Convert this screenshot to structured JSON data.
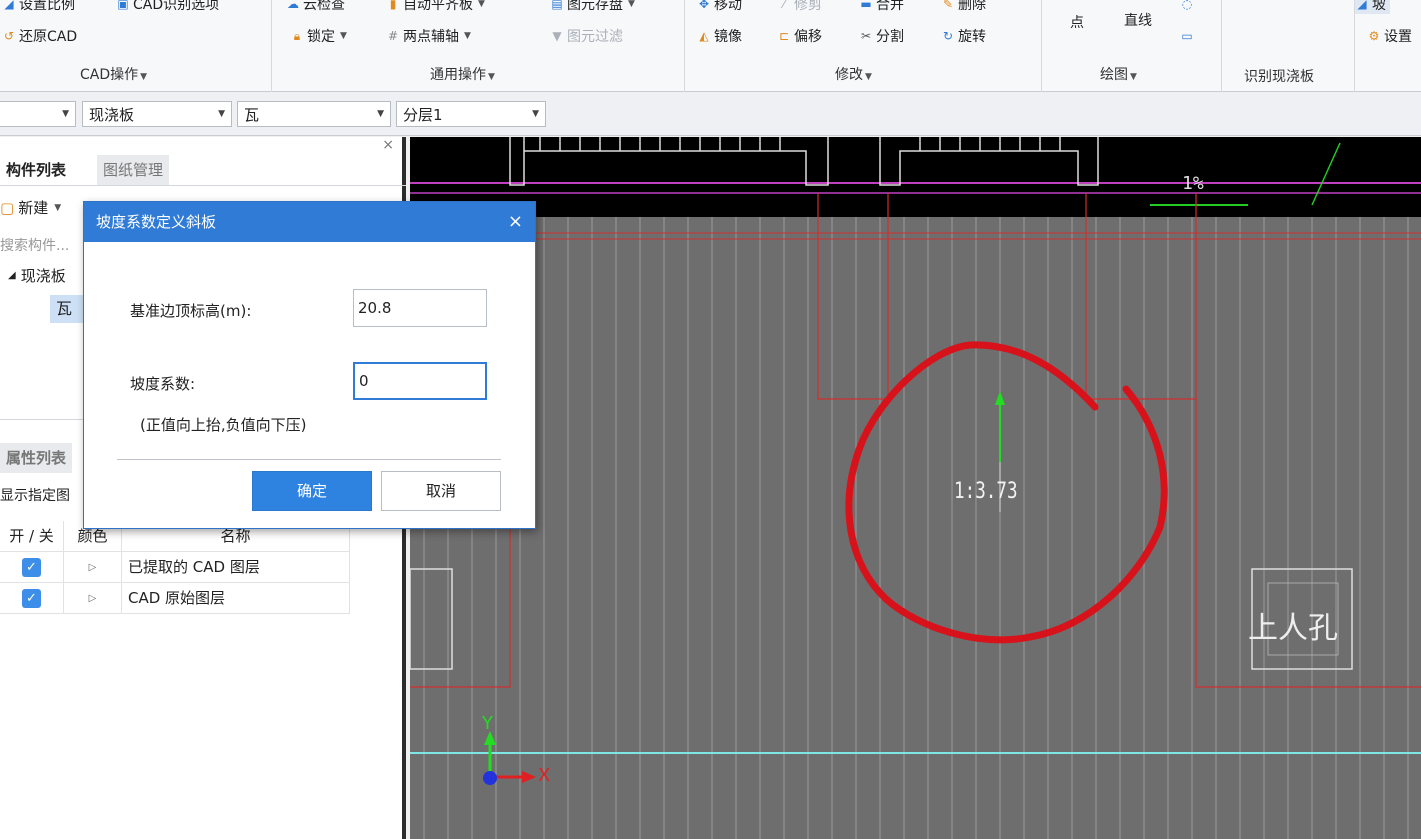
{
  "ribbon": {
    "cad_ops": {
      "set_scale": "设置比例",
      "cad_options": "CAD识别选项",
      "restore_cad": "还原CAD",
      "label": "CAD操作"
    },
    "common_ops": {
      "cloud_check": "云检查",
      "auto_level": "自动平齐板",
      "element_save": "图元存盘",
      "lock": "锁定",
      "two_point_axis": "两点辅轴",
      "element_filter": "图元过滤",
      "label": "通用操作"
    },
    "modify": {
      "move": "移动",
      "trim": "修剪",
      "merge": "合并",
      "delete": "删除",
      "mirror": "镜像",
      "offset": "偏移",
      "split": "分割",
      "rotate": "旋转",
      "label": "修改"
    },
    "draw": {
      "point": "点",
      "line": "直线",
      "label": "绘图"
    },
    "recognize": {
      "label": "识别现浇板"
    },
    "slope": {
      "slope_top": "坡",
      "settings": "设置"
    }
  },
  "selectors": {
    "s1": "",
    "s2": "现浇板",
    "s3": "瓦",
    "s4": "分层1"
  },
  "left_panel": {
    "tab_components": "构件列表",
    "tab_drawings": "图纸管理",
    "new_btn": "新建",
    "search_placeholder": "搜索构件...",
    "tree_root": "现浇板",
    "tree_child": "瓦",
    "tab_props": "属性列表",
    "show_layers": "显示指定图",
    "close_symbol": "×"
  },
  "layer_table": {
    "headers": [
      "开 / 关",
      "颜色",
      "名称"
    ],
    "rows": [
      {
        "name": "已提取的 CAD 图层"
      },
      {
        "name": "CAD 原始图层"
      }
    ]
  },
  "dialog": {
    "title": "坡度系数定义斜板",
    "base_elev_label": "基准边顶标高(m):",
    "base_elev_value": "20.8",
    "slope_label": "坡度系数:",
    "slope_value": "0",
    "hint": "(正值向上抬,负值向下压)",
    "ok": "确定",
    "cancel": "取消"
  },
  "cad": {
    "percent_label": "1%",
    "slope_ratio": "1:3.73",
    "hole_label": "上人孔",
    "axis_x": "X",
    "axis_y": "Y"
  },
  "colors": {
    "accent": "#2f7bd6",
    "cad_bg": "#6e6e6e",
    "annotation_red": "#d8121b"
  }
}
